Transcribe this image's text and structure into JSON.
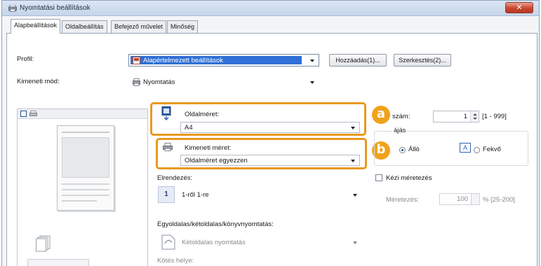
{
  "window": {
    "title": "Nyomtatási beállítások",
    "close_label": "✕"
  },
  "tabs": [
    {
      "label": "Alapbeállítások",
      "active": true
    },
    {
      "label": "Oldalbeállítás",
      "active": false
    },
    {
      "label": "Befejező művelet",
      "active": false
    },
    {
      "label": "Minőség",
      "active": false
    }
  ],
  "profile": {
    "label": "Profil:",
    "value": "Alapértelmezett beállítások",
    "add_button": "Hozzáadás(1)...",
    "edit_button": "Szerkesztés(2)..."
  },
  "output_method": {
    "label": "Kimeneti mód:",
    "value": "Nyomtatás"
  },
  "page_size": {
    "label": "Oldalméret:",
    "value": "A4"
  },
  "output_size": {
    "label": "Kimeneti méret:",
    "value": "Oldalméret egyezzen"
  },
  "copies": {
    "label": "szám:",
    "value": "1",
    "range": "[1 - 999]"
  },
  "orientation": {
    "label": "ájás",
    "portrait_label": "Álló",
    "portrait_glyph": "A",
    "landscape_label": "Fekvő",
    "landscape_glyph": "A",
    "selected": "portrait"
  },
  "layout": {
    "label": "Elrendezés:",
    "value": "1-ről 1-re",
    "icon_glyph": "1"
  },
  "manual_scaling": {
    "label": "Kézi méretezés",
    "checked": false,
    "scale_label": "Méretezés:",
    "scale_value": "100",
    "scale_range": "% [25-200]"
  },
  "duplex": {
    "label": "Egyoldalas/kétoldalas/könyvnyomtatás:",
    "value": "Kétoldalas nyomtatás"
  },
  "binding": {
    "label": "Kötés helye:"
  },
  "badges": {
    "a": "a",
    "b": "b"
  },
  "colors": {
    "highlight": "#e89a1e",
    "badge": "#f0a21a",
    "profile_select": "#2f6fd6"
  }
}
